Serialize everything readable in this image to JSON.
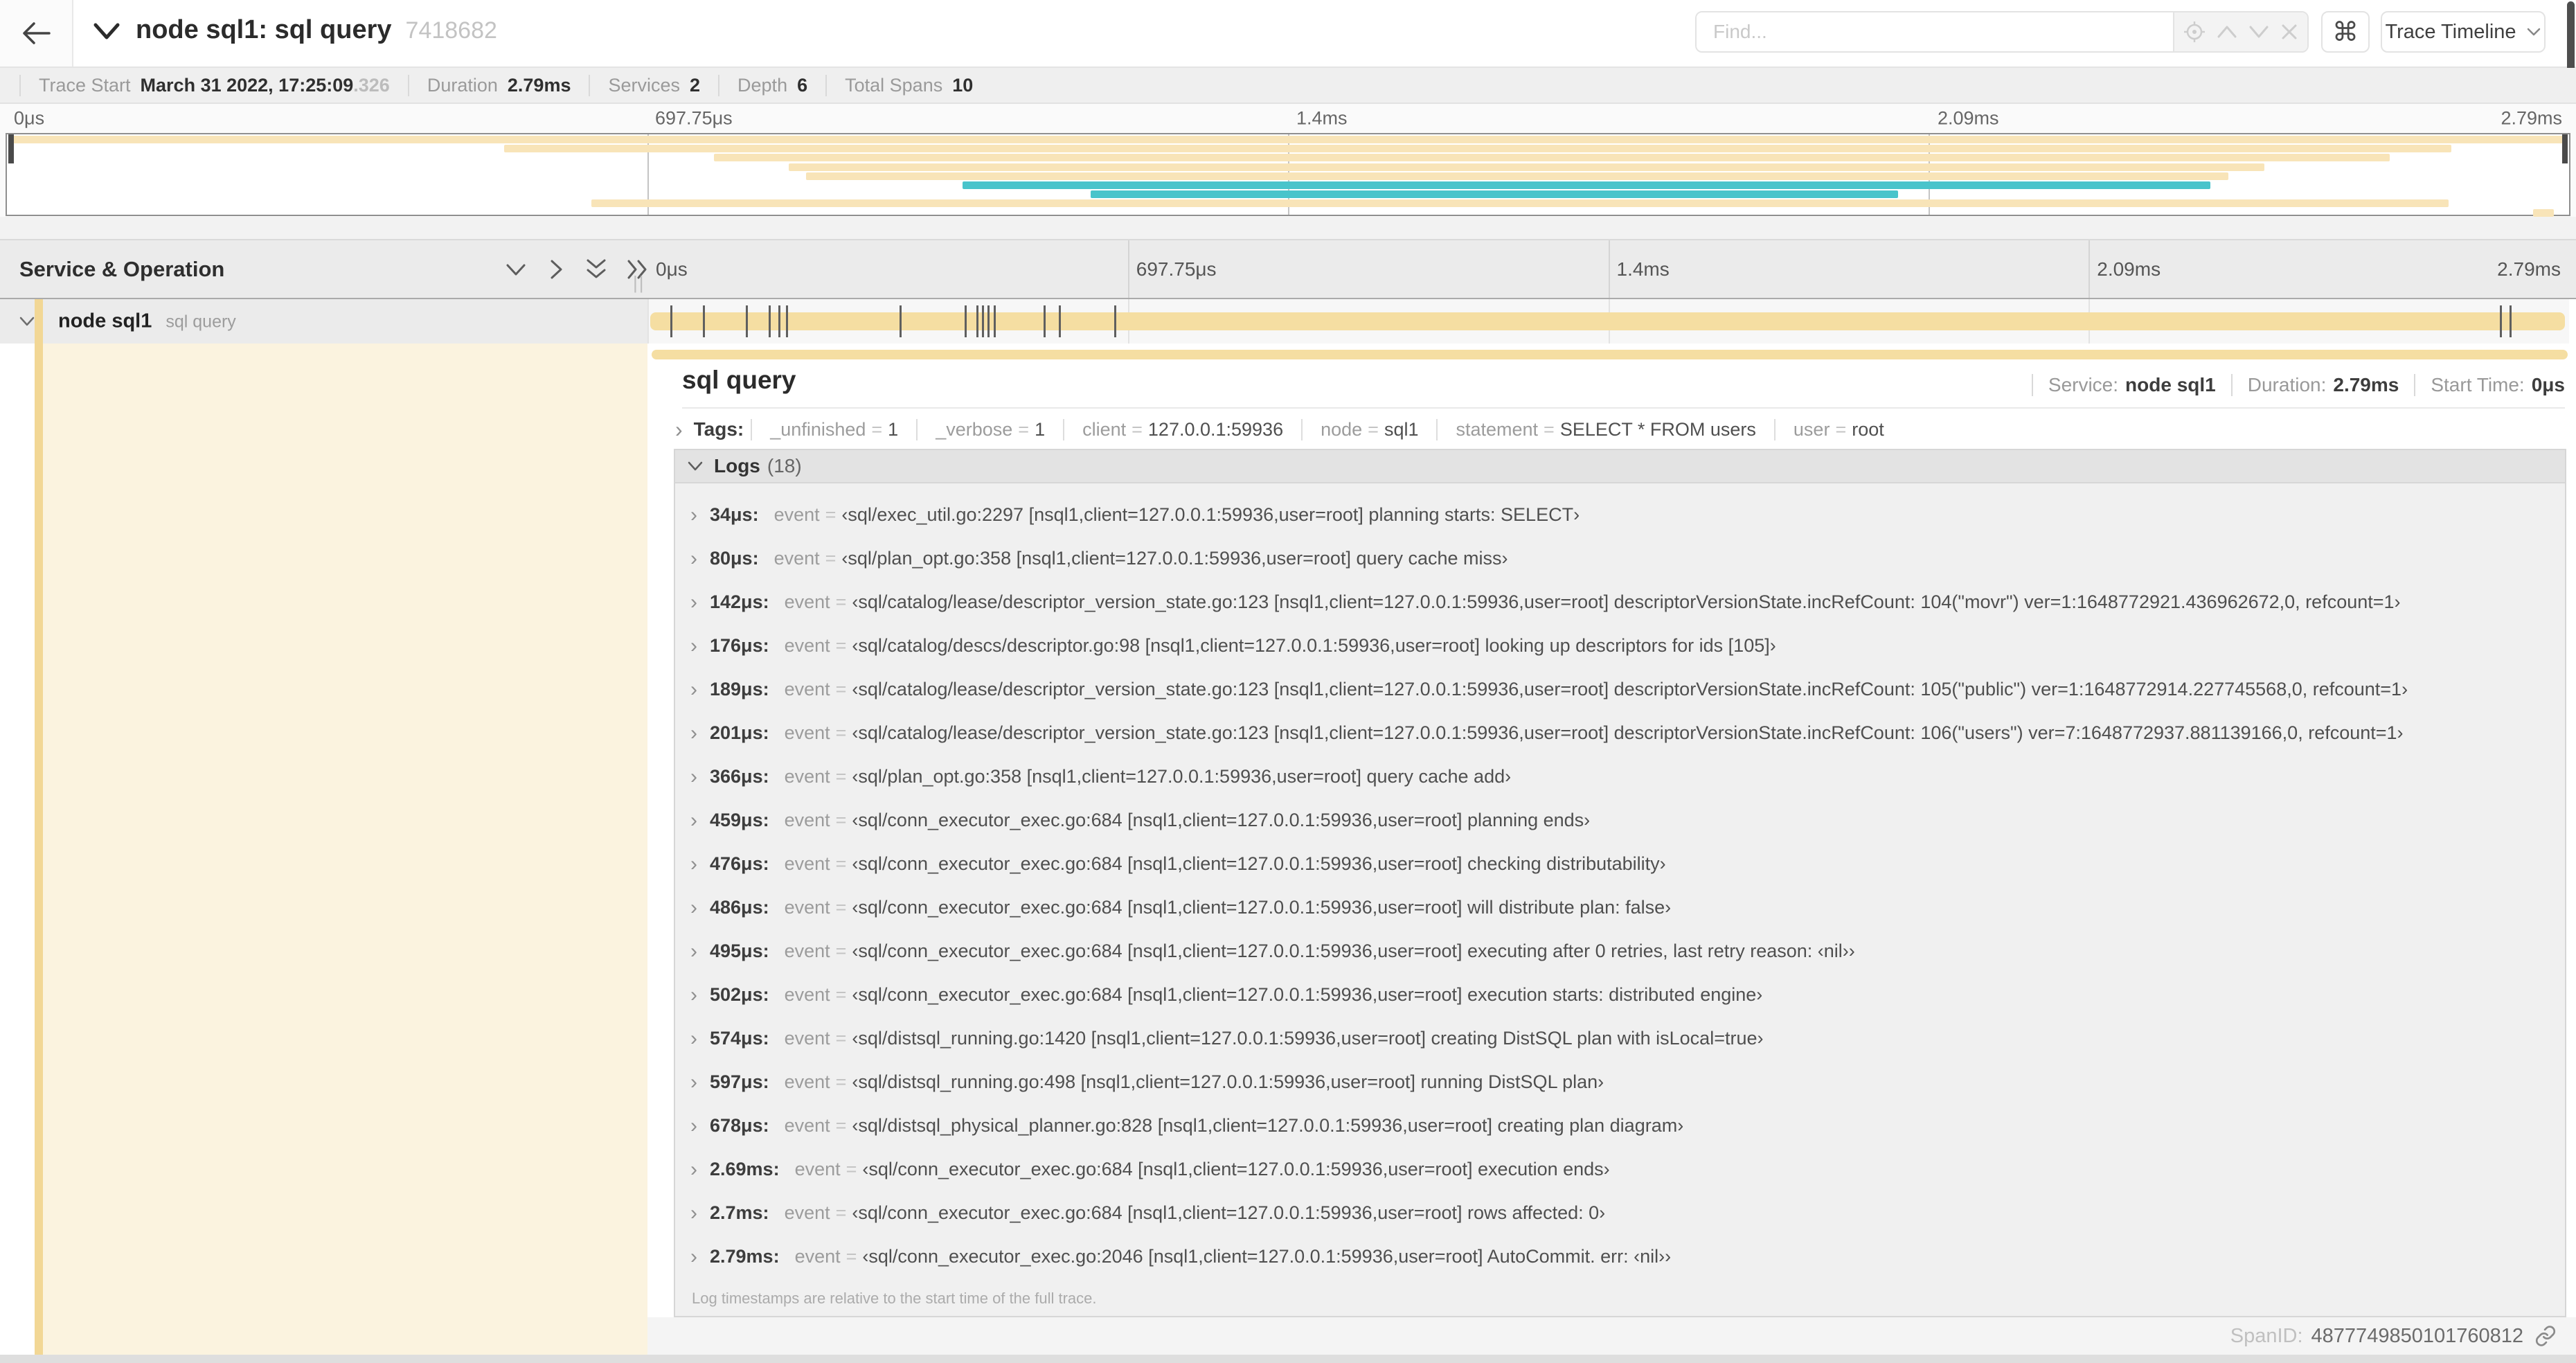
{
  "colors": {
    "tan": "#f8e4b8",
    "teal": "#49c4cb",
    "bar": "#f5dea2",
    "stripe": "#f2d795",
    "cream": "#fbf3df"
  },
  "topbar": {
    "title": "node sql1: sql query",
    "trace_id": "7418682",
    "find_placeholder": "Find...",
    "cmd_glyph": "⌘",
    "view_button": "Trace Timeline"
  },
  "metabar": {
    "items": [
      {
        "label": "Trace Start",
        "value": "March 31 2022, 17:25:09",
        "suffix": ".326"
      },
      {
        "label": "Duration",
        "value": "2.79ms",
        "suffix": ""
      },
      {
        "label": "Services",
        "value": "2",
        "suffix": ""
      },
      {
        "label": "Depth",
        "value": "6",
        "suffix": ""
      },
      {
        "label": "Total Spans",
        "value": "10",
        "suffix": ""
      }
    ]
  },
  "minimap": {
    "ticks": [
      {
        "label": "0μs",
        "pct": 0
      },
      {
        "label": "697.75μs",
        "pct": 25
      },
      {
        "label": "1.4ms",
        "pct": 50
      },
      {
        "label": "2.09ms",
        "pct": 75
      },
      {
        "label": "2.79ms",
        "pct": 100
      }
    ],
    "spans": [
      {
        "start": 0.2,
        "end": 99.8,
        "color": "tan"
      },
      {
        "start": 19.4,
        "end": 95.4,
        "color": "tan"
      },
      {
        "start": 27.6,
        "end": 93.0,
        "color": "tan"
      },
      {
        "start": 30.5,
        "end": 88.1,
        "color": "tan"
      },
      {
        "start": 31.2,
        "end": 86.7,
        "color": "tan"
      },
      {
        "start": 37.3,
        "end": 86.0,
        "color": "teal"
      },
      {
        "start": 42.3,
        "end": 73.8,
        "color": "teal"
      },
      {
        "start": 22.8,
        "end": 95.3,
        "color": "tan"
      },
      {
        "start": 98.6,
        "end": 99.4,
        "color": "tan"
      }
    ]
  },
  "timeline": {
    "left_header": "Service & Operation",
    "grip": "||",
    "ruler": [
      {
        "label": "0μs",
        "pct": 0
      },
      {
        "label": "697.75μs",
        "pct": 25
      },
      {
        "label": "1.4ms",
        "pct": 50
      },
      {
        "label": "2.09ms",
        "pct": 75
      },
      {
        "label": "2.79ms",
        "pct": 100
      }
    ],
    "row": {
      "service": "node sql1",
      "operation": "sql query"
    },
    "log_ticks": [
      1.2,
      2.9,
      5.1,
      6.3,
      6.8,
      7.2,
      13.1,
      16.5,
      17.1,
      17.4,
      17.7,
      18.0,
      20.6,
      21.4,
      24.3,
      96.4,
      96.9
    ]
  },
  "detail": {
    "title": "sql query",
    "overview": [
      {
        "label": "Service:",
        "value": "node sql1"
      },
      {
        "label": "Duration:",
        "value": "2.79ms"
      },
      {
        "label": "Start Time:",
        "value": "0μs"
      }
    ],
    "chevron": "›",
    "tags_label": "Tags:",
    "tags": [
      {
        "key": "_unfinished",
        "eq": "=",
        "value": "1"
      },
      {
        "key": "_verbose",
        "eq": "=",
        "value": "1"
      },
      {
        "key": "client",
        "eq": "=",
        "value": "127.0.0.1:59936"
      },
      {
        "key": "node",
        "eq": "=",
        "value": "sql1"
      },
      {
        "key": "statement",
        "eq": "=",
        "value": "SELECT * FROM users"
      },
      {
        "key": "user",
        "eq": "=",
        "value": "root"
      }
    ],
    "logs_label": "Logs",
    "logs_count": "(18)",
    "logs": [
      {
        "chev": "›",
        "time": "34μs:",
        "key": "event",
        "eq": "=",
        "value": "‹sql/exec_util.go:2297 [nsql1,client=127.0.0.1:59936,user=root] planning starts: SELECT›"
      },
      {
        "chev": "›",
        "time": "80μs:",
        "key": "event",
        "eq": "=",
        "value": "‹sql/plan_opt.go:358 [nsql1,client=127.0.0.1:59936,user=root] query cache miss›"
      },
      {
        "chev": "›",
        "time": "142μs:",
        "key": "event",
        "eq": "=",
        "value": "‹sql/catalog/lease/descriptor_version_state.go:123 [nsql1,client=127.0.0.1:59936,user=root] descriptorVersionState.incRefCount: 104(\"movr\") ver=1:1648772921.436962672,0, refcount=1›"
      },
      {
        "chev": "›",
        "time": "176μs:",
        "key": "event",
        "eq": "=",
        "value": "‹sql/catalog/descs/descriptor.go:98 [nsql1,client=127.0.0.1:59936,user=root] looking up descriptors for ids [105]›"
      },
      {
        "chev": "›",
        "time": "189μs:",
        "key": "event",
        "eq": "=",
        "value": "‹sql/catalog/lease/descriptor_version_state.go:123 [nsql1,client=127.0.0.1:59936,user=root] descriptorVersionState.incRefCount: 105(\"public\") ver=1:1648772914.227745568,0, refcount=1›"
      },
      {
        "chev": "›",
        "time": "201μs:",
        "key": "event",
        "eq": "=",
        "value": "‹sql/catalog/lease/descriptor_version_state.go:123 [nsql1,client=127.0.0.1:59936,user=root] descriptorVersionState.incRefCount: 106(\"users\") ver=7:1648772937.881139166,0, refcount=1›"
      },
      {
        "chev": "›",
        "time": "366μs:",
        "key": "event",
        "eq": "=",
        "value": "‹sql/plan_opt.go:358 [nsql1,client=127.0.0.1:59936,user=root] query cache add›"
      },
      {
        "chev": "›",
        "time": "459μs:",
        "key": "event",
        "eq": "=",
        "value": "‹sql/conn_executor_exec.go:684 [nsql1,client=127.0.0.1:59936,user=root] planning ends›"
      },
      {
        "chev": "›",
        "time": "476μs:",
        "key": "event",
        "eq": "=",
        "value": "‹sql/conn_executor_exec.go:684 [nsql1,client=127.0.0.1:59936,user=root] checking distributability›"
      },
      {
        "chev": "›",
        "time": "486μs:",
        "key": "event",
        "eq": "=",
        "value": "‹sql/conn_executor_exec.go:684 [nsql1,client=127.0.0.1:59936,user=root] will distribute plan: false›"
      },
      {
        "chev": "›",
        "time": "495μs:",
        "key": "event",
        "eq": "=",
        "value": "‹sql/conn_executor_exec.go:684 [nsql1,client=127.0.0.1:59936,user=root] executing after 0 retries, last retry reason: ‹nil››"
      },
      {
        "chev": "›",
        "time": "502μs:",
        "key": "event",
        "eq": "=",
        "value": "‹sql/conn_executor_exec.go:684 [nsql1,client=127.0.0.1:59936,user=root] execution starts: distributed engine›"
      },
      {
        "chev": "›",
        "time": "574μs:",
        "key": "event",
        "eq": "=",
        "value": "‹sql/distsql_running.go:1420 [nsql1,client=127.0.0.1:59936,user=root] creating DistSQL plan with isLocal=true›"
      },
      {
        "chev": "›",
        "time": "597μs:",
        "key": "event",
        "eq": "=",
        "value": "‹sql/distsql_running.go:498 [nsql1,client=127.0.0.1:59936,user=root] running DistSQL plan›"
      },
      {
        "chev": "›",
        "time": "678μs:",
        "key": "event",
        "eq": "=",
        "value": "‹sql/distsql_physical_planner.go:828 [nsql1,client=127.0.0.1:59936,user=root] creating plan diagram›"
      },
      {
        "chev": "›",
        "time": "2.69ms:",
        "key": "event",
        "eq": "=",
        "value": "‹sql/conn_executor_exec.go:684 [nsql1,client=127.0.0.1:59936,user=root] execution ends›"
      },
      {
        "chev": "›",
        "time": "2.7ms:",
        "key": "event",
        "eq": "=",
        "value": "‹sql/conn_executor_exec.go:684 [nsql1,client=127.0.0.1:59936,user=root] rows affected: 0›"
      },
      {
        "chev": "›",
        "time": "2.79ms:",
        "key": "event",
        "eq": "=",
        "value": "‹sql/conn_executor_exec.go:2046 [nsql1,client=127.0.0.1:59936,user=root] AutoCommit. err: ‹nil››"
      }
    ],
    "logs_note": "Log timestamps are relative to the start time of the full trace.",
    "span_id_label": "SpanID:",
    "span_id": "4877749850101760812"
  }
}
